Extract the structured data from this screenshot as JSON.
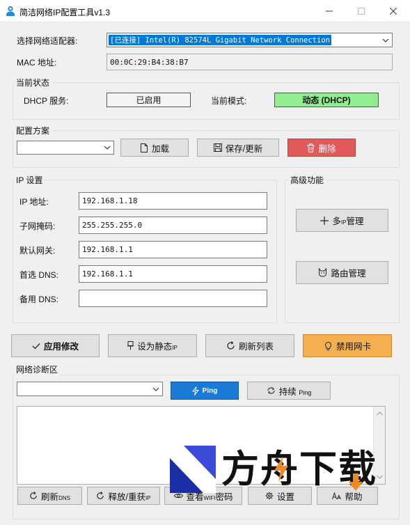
{
  "window": {
    "title": "简洁网络IP配置工具v1.3"
  },
  "adapter": {
    "label": "选择网络适配器:",
    "selected": "[已连接] Intel(R) 82574L Gigabit Network Connection",
    "mac_label": "MAC 地址:",
    "mac_value": "00:0C:29:B4:38:B7"
  },
  "status": {
    "group_title": "当前状态",
    "dhcp_label": "DHCP 服务:",
    "dhcp_value": "已启用",
    "mode_label": "当前模式:",
    "mode_value": "动态 (DHCP)",
    "mode_color": "#90ee90"
  },
  "profile": {
    "group_title": "配置方案",
    "selected": "",
    "load_label": "加载",
    "save_label": "保存/更新",
    "delete_label": "删除",
    "delete_color": "#e05a5a"
  },
  "ip_settings": {
    "group_title": "IP 设置",
    "ip_label": "IP 地址:",
    "ip_value": "192.168.1.18",
    "mask_label": "子网掩码:",
    "mask_value": "255.255.255.0",
    "gateway_label": "默认网关:",
    "gateway_value": "192.168.1.1",
    "dns1_label": "首选 DNS:",
    "dns1_value": "192.168.1.1",
    "dns2_label": "备用 DNS:",
    "dns2_value": ""
  },
  "advanced": {
    "group_title": "高级功能",
    "multi_ip_prefix": "多",
    "multi_ip_small": "IP",
    "multi_ip_suffix": "管理",
    "route_label": "路由管理"
  },
  "actions": {
    "apply_label": "应用修改",
    "static_label": "设为静态",
    "static_small": "IP",
    "refresh_label": "刷新列表",
    "disable_label": "禁用网卡",
    "disable_color": "#f4b04e"
  },
  "diagnostics": {
    "group_title": "网络诊断区",
    "target": "",
    "ping_label": "Ping",
    "ping_color": "#1a7ad6",
    "continuous_label": "持续",
    "continuous_small": "Ping",
    "output": ""
  },
  "bottom": {
    "flush_dns_label": "刷新",
    "flush_dns_small": "DNS",
    "release_label": "释放/重获",
    "release_small": "IP",
    "wifi_label_prefix": "查看",
    "wifi_small": "WIFI",
    "wifi_label_suffix": "密码",
    "settings_label": "设置",
    "help_label": "帮助"
  },
  "watermark": {
    "text": "方舟下载"
  }
}
